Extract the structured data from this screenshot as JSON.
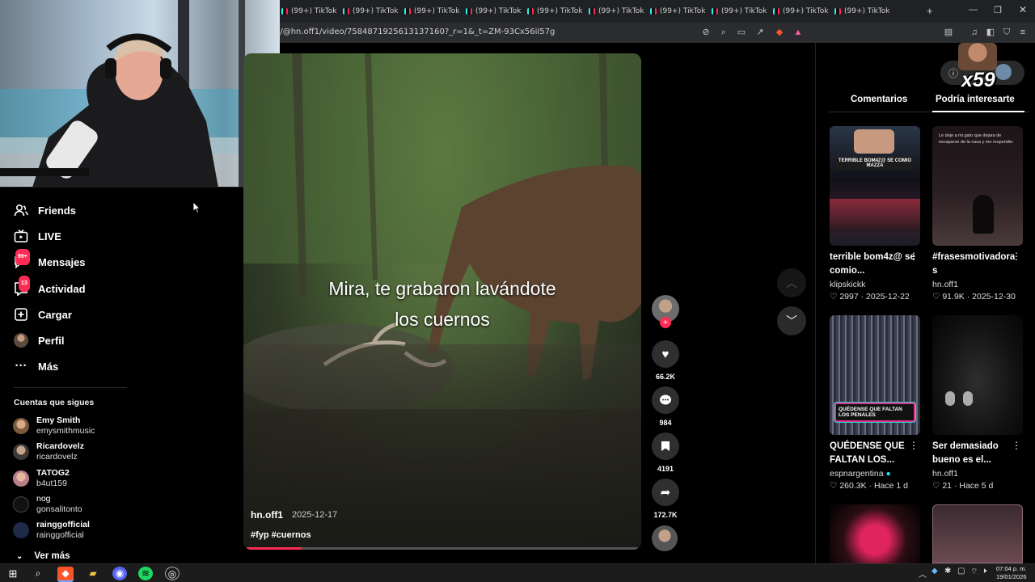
{
  "browser": {
    "tab_label": "(99+) TikTok",
    "tabs_count": 10,
    "url": "n/@hn.off1/video/7584871925613137160?_r=1&_t=ZM-93Cx56iI57g"
  },
  "sidebar": {
    "items": [
      {
        "label": "Friends",
        "icon": "friends-icon"
      },
      {
        "label": "LIVE",
        "icon": "live-icon"
      },
      {
        "label": "Mensajes",
        "icon": "messages-icon",
        "badge": "99+"
      },
      {
        "label": "Actividad",
        "icon": "activity-icon",
        "badge": "13"
      },
      {
        "label": "Cargar",
        "icon": "upload-icon"
      },
      {
        "label": "Perfil",
        "icon": "profile-icon"
      },
      {
        "label": "Más",
        "icon": "more-icon"
      }
    ],
    "following_title": "Cuentas que sigues",
    "accounts": [
      {
        "name": "Emy Smith",
        "handle": "emysmithmusic"
      },
      {
        "name": "Ricardovelz",
        "handle": "ricardovelz"
      },
      {
        "name": "TATOG2",
        "handle": "b4ut159"
      },
      {
        "name": "nog",
        "handle": "gonsalitonto"
      },
      {
        "name": "rainggofficial",
        "handle": "rainggofficial"
      }
    ],
    "see_more": "Ver más"
  },
  "video": {
    "caption_line1": "Mira, te grabaron lavándote",
    "caption_line2": "los cuernos",
    "author": "hn.off1",
    "date": "2025-12-17",
    "hashtags": "#fyp #cuernos",
    "progress": 0.14
  },
  "actions": {
    "likes": "66.2K",
    "comments": "984",
    "saves": "4191",
    "shares": "172.7K"
  },
  "right_panel": {
    "streak_count": "x59",
    "tab_comments": "Comentarios",
    "tab_recommended": "Podría interesarte",
    "cards": [
      {
        "title": "terrible bom4z@ se comio...",
        "author": "klipskickk",
        "likes": "2997",
        "date": "2025-12-22",
        "thumb_text": "TERRIBLE BOM4Z@ SE COMIO MAZZA"
      },
      {
        "title": "#frasesmotivadora s",
        "author": "hn.off1",
        "likes": "91.9K",
        "date": "2025-12-30",
        "thumb_text": "Le deje a mi gato que dejara de escaparse de la casa y me respondio:"
      },
      {
        "title": "QUÉDENSE QUE FALTAN LOS...",
        "author": "espnargentina",
        "likes": "260.3K",
        "date": "Hace 1 d",
        "thumb_text": "QUÉDENSE QUE FALTAN LOS PENALES"
      },
      {
        "title": "Ser demasiado bueno es el...",
        "author": "hn.off1",
        "likes": "21",
        "date": "Hace 5 d",
        "thumb_text": ""
      }
    ]
  },
  "taskbar": {
    "time": "07:04 p. m.",
    "date": "19/01/2026"
  }
}
